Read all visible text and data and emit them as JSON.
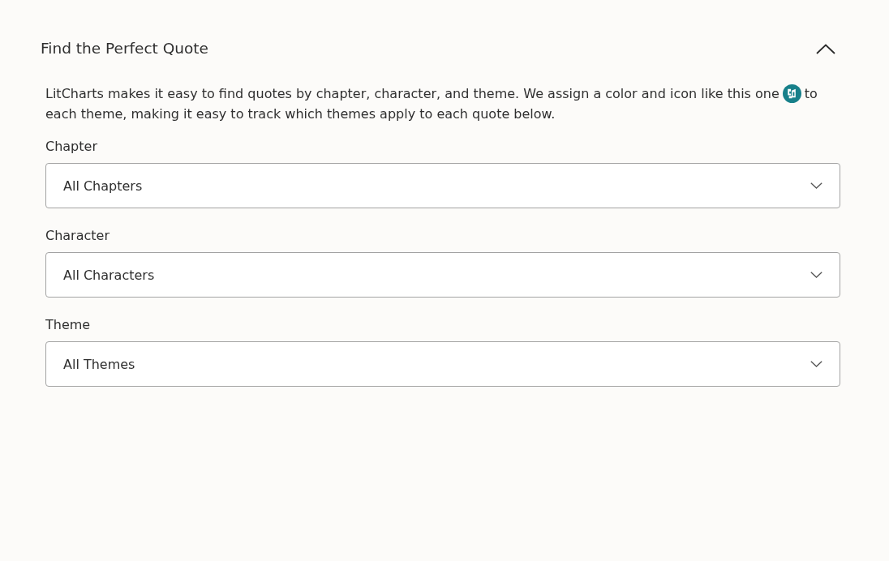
{
  "section": {
    "title": "Find the Perfect Quote",
    "expanded": true,
    "intro": {
      "text_before_icon": "LitCharts makes it easy to find quotes by chapter, character, and theme. We assign a color and icon like this one",
      "text_after_icon": "to each theme, making it easy to track which themes apply to each quote below."
    },
    "filters": [
      {
        "label": "Chapter",
        "value": "All Chapters"
      },
      {
        "label": "Character",
        "value": "All Characters"
      },
      {
        "label": "Theme",
        "value": "All Themes"
      }
    ]
  }
}
